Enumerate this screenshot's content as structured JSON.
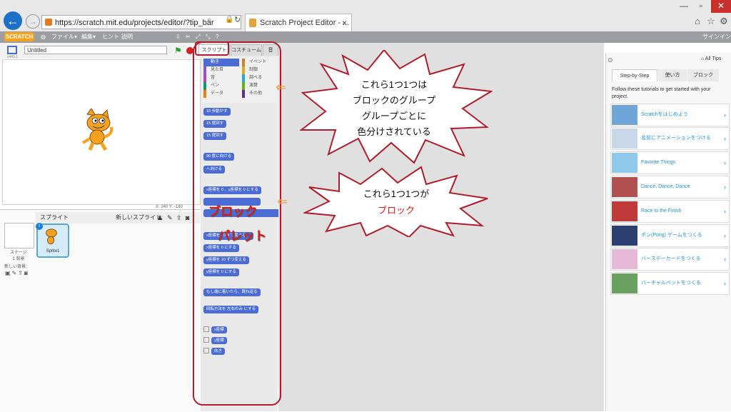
{
  "browser": {
    "url": "https://scratch.mit.edu/projects/editor/?tip_bar",
    "tab_title": "Scratch Project Editor - ...",
    "tab_close": "×",
    "window_buttons": [
      "—",
      "▫",
      "✕"
    ],
    "icons": [
      "home-icon",
      "star-icon",
      "gear-icon"
    ]
  },
  "menubar": {
    "logo": "SCRATCH",
    "items": [
      "ファイル▾",
      "編集▾",
      "ヒント",
      "説明"
    ],
    "sign_in": "サインイン"
  },
  "stage": {
    "project_title": "Untitled",
    "version": "v443.1",
    "coords": "X: 240  Y: -180"
  },
  "sprites": {
    "header": "スプライト",
    "new_sprite": "新しいスプライト:",
    "stage_label": "ステージ\n1 背景",
    "new_backdrop": "新しい背景:",
    "sprite1": "Sprite1"
  },
  "palette": {
    "tabs": [
      "スクリプト",
      "コスチューム",
      "音"
    ],
    "categories_left": [
      "動き",
      "見た目",
      "音",
      "ペン",
      "データ"
    ],
    "categories_right": [
      "イベント",
      "制御",
      "調べる",
      "演算",
      "その他"
    ],
    "cat_colors_left": [
      "#4a6cd4",
      "#8a55d7",
      "#bb42c3",
      "#0e9a6c",
      "#ee7d16"
    ],
    "cat_colors_right": [
      "#c88330",
      "#e1a91a",
      "#2ca5e2",
      "#5cb712",
      "#632d99"
    ],
    "blocks": [
      "10 歩動かす",
      "15 度回す",
      "15 度回す",
      "90 度に向ける",
      "へ向ける",
      "x座標を 0 、y座標を 0 にする",
      "x座標を 10 ずつ変える",
      "x座標を 0 にする",
      "y座標を 10 ずつ変える",
      "y座標を 0 にする",
      "もし端に着いたら、跳ね返る",
      "回転方法を 左右のみ にする"
    ],
    "checkboxes": [
      "x座標",
      "y座標",
      "向き"
    ]
  },
  "annotations": {
    "callout1": [
      "これら1つ1つは",
      "ブロックのグループ",
      "グループごとに",
      "色分けされている"
    ],
    "callout2_line1": "これら1つ1つが",
    "callout2_line2": "ブロック",
    "label_line1": "ブロック",
    "label_line2": "パレット"
  },
  "tips": {
    "all_tips": "All Tips",
    "tabs": [
      "Step-by-Step",
      "使い方",
      "ブロック"
    ],
    "intro": "Follow these tutorials to get started with your project.",
    "items": [
      "Scratchをはじめよう",
      "名前にアニメーションをつける",
      "Favorite Things",
      "Dance, Dance, Dance",
      "Race to the Finish",
      "ポン(Pong) ゲームをつくる",
      "バースデーカードをつくる",
      "バーチャルペットをつくる"
    ],
    "arrow": "›"
  },
  "colors": {
    "accent_blue": "#4a6cd4",
    "annotation_red": "#e01818",
    "box_red": "#b01c2c",
    "tip_link": "#1a8fcf"
  }
}
